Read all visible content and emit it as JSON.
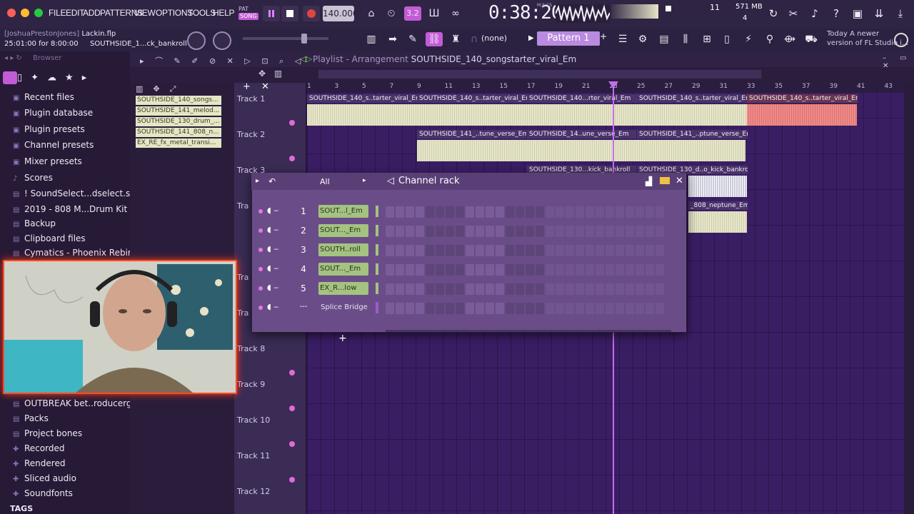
{
  "menu": {
    "items": [
      "FILE",
      "EDIT",
      "ADD",
      "PATTERNS",
      "VIEW",
      "OPTIONS",
      "TOOLS",
      "HELP"
    ],
    "pat_song": {
      "pat": "PAT",
      "song": "SONG"
    }
  },
  "transport": {
    "tempo": "140.000",
    "time": "0:38:20",
    "time_label": "M:S:CS",
    "cpu": "11",
    "memory": "571 MB",
    "polyphony": "4",
    "snap": "(none)",
    "pattern": "Pattern 1",
    "news_title": "Today  A newer",
    "news_body": "version of FL Studio i..."
  },
  "project": {
    "user": "[JoshuaPrestonJones]",
    "file": "Lackin.flp",
    "hint": "25:01:00 for 8:00:00",
    "hint2": "SOUTHSIDE_1...ck_bankroll"
  },
  "browser": {
    "header": "Browser",
    "items": [
      {
        "label": "Recent files",
        "icon": "recent"
      },
      {
        "label": "Plugin database",
        "icon": "plugin"
      },
      {
        "label": "Plugin presets",
        "icon": "plugin"
      },
      {
        "label": "Channel presets",
        "icon": "channel"
      },
      {
        "label": "Mixer presets",
        "icon": "mixer"
      },
      {
        "label": "Scores",
        "icon": "note"
      },
      {
        "label": "! SoundSelect...dselect.store)",
        "icon": "folder"
      },
      {
        "label": "2019 - 808 M...Drum Kit (THP)",
        "icon": "folder"
      },
      {
        "label": "Backup",
        "icon": "folder"
      },
      {
        "label": "Clipboard files",
        "icon": "folder"
      },
      {
        "label": "Cymatics - Phoenix Rebirth",
        "icon": "folder"
      },
      {
        "label": "OUTBREAK bet..roducergrind)",
        "icon": "folder"
      },
      {
        "label": "Packs",
        "icon": "folder"
      },
      {
        "label": "Project bones",
        "icon": "folder"
      },
      {
        "label": "Recorded",
        "icon": "folder"
      },
      {
        "label": "Rendered",
        "icon": "folder"
      },
      {
        "label": "Sliced audio",
        "icon": "folder"
      },
      {
        "label": "Soundfonts",
        "icon": "folder"
      }
    ],
    "tags": "TAGS"
  },
  "playlist": {
    "title_prefix": "Playlist - Arrangement",
    "title": "SOUTHSIDE_140_songstarter_viral_Em",
    "picker_clips": [
      "SOUTHSIDE_140_songs...",
      "SOUTHSIDE_141_melod...",
      "SOUTHSIDE_130_drum_...",
      "SOUTHSIDE_141_808_n...",
      "EX_RE_fx_metal_transi..."
    ],
    "ruler": [
      "1",
      "3",
      "5",
      "7",
      "9",
      "11",
      "13",
      "15",
      "17",
      "19",
      "21",
      "23",
      "25",
      "27",
      "29",
      "31",
      "33",
      "35",
      "37",
      "39",
      "41",
      "43"
    ],
    "tracks": [
      "Track 1",
      "Track 2",
      "Track 3",
      "Tra",
      "",
      "Tra",
      "",
      "Tra",
      "Track 8",
      "Track 9",
      "Track 10",
      "Track 11",
      "Track 12"
    ],
    "clips": {
      "t1a": "SOUTHSIDE_140_s..tarter_viral_Em",
      "t1b": "SOUTHSIDE_140_s..tarter_viral_Em",
      "t1c": "SOUTHSIDE_140...rter_viral_Em",
      "t1d": "SOUTHSIDE_140_s..tarter_viral_Em",
      "t1e": "SOUTHSIDE_140_s..tarter_viral_Em",
      "t2a": "SOUTHSIDE_141_..tune_verse_Em",
      "t2b": "SOUTHSIDE_14..une_verse_Em",
      "t2c": "SOUTHSIDE_141_..ptune_verse_Em",
      "t3a": "SOUTHSIDE_130...kick_bankroll",
      "t3b": "SOUTHSIDE_130_d..o_kick_bankroll",
      "t4a": "_808_neptune_Em"
    }
  },
  "channel_rack": {
    "filter": "All",
    "title": "Channel rack",
    "channels": [
      {
        "num": "1",
        "name": "SOUT...l_Em"
      },
      {
        "num": "2",
        "name": "SOUT..._Em"
      },
      {
        "num": "3",
        "name": "SOUTH..roll"
      },
      {
        "num": "4",
        "name": "SOUT..._Em"
      },
      {
        "num": "5",
        "name": "EX_R...low"
      },
      {
        "num": "---",
        "name": "Splice Bridge"
      }
    ],
    "add": "+"
  },
  "colors": {
    "accent": "#c45bd6",
    "clip_default": "#e6e5c8",
    "clip_red": "#f08a88",
    "playlist_bg": "#3a1e64",
    "channel_name": "#a4c280"
  }
}
